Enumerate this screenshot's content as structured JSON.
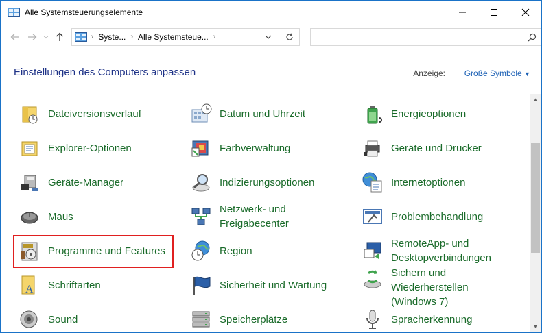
{
  "window": {
    "title": "Alle Systemsteuerungselemente"
  },
  "address": {
    "crumbs": [
      "Syste...",
      "Alle Systemsteue..."
    ]
  },
  "search": {
    "placeholder": ""
  },
  "header": {
    "title": "Einstellungen des Computers anpassen",
    "view_label": "Anzeige:",
    "view_value": "Große Symbole"
  },
  "items": [
    {
      "label": "Dateiversionsverlauf",
      "icon": "file-history-icon"
    },
    {
      "label": "Datum und Uhrzeit",
      "icon": "date-time-icon"
    },
    {
      "label": "Energieoptionen",
      "icon": "power-options-icon"
    },
    {
      "label": "Explorer-Optionen",
      "icon": "explorer-options-icon"
    },
    {
      "label": "Farbverwaltung",
      "icon": "color-management-icon"
    },
    {
      "label": "Geräte und Drucker",
      "icon": "devices-printers-icon"
    },
    {
      "label": "Geräte-Manager",
      "icon": "device-manager-icon"
    },
    {
      "label": "Indizierungsoptionen",
      "icon": "indexing-options-icon"
    },
    {
      "label": "Internetoptionen",
      "icon": "internet-options-icon"
    },
    {
      "label": "Maus",
      "icon": "mouse-icon"
    },
    {
      "label": "Netzwerk- und Freigabecenter",
      "icon": "network-sharing-icon"
    },
    {
      "label": "Problembehandlung",
      "icon": "troubleshooting-icon"
    },
    {
      "label": "Programme und Features",
      "icon": "programs-features-icon"
    },
    {
      "label": "Region",
      "icon": "region-icon"
    },
    {
      "label": "RemoteApp- und Desktopverbindungen",
      "icon": "remoteapp-icon"
    },
    {
      "label": "Schriftarten",
      "icon": "fonts-icon"
    },
    {
      "label": "Sicherheit und Wartung",
      "icon": "security-maintenance-icon"
    },
    {
      "label": "Sichern und Wiederherstellen (Windows 7)",
      "icon": "backup-restore-icon"
    },
    {
      "label": "Sound",
      "icon": "sound-icon"
    },
    {
      "label": "Speicherplätze",
      "icon": "storage-spaces-icon"
    },
    {
      "label": "Spracherkennung",
      "icon": "speech-recognition-icon"
    }
  ],
  "colors": {
    "title_blue": "#1e3287",
    "item_green": "#1a6b2a",
    "highlight_red": "#e02020",
    "link_blue": "#1a5fb4"
  }
}
